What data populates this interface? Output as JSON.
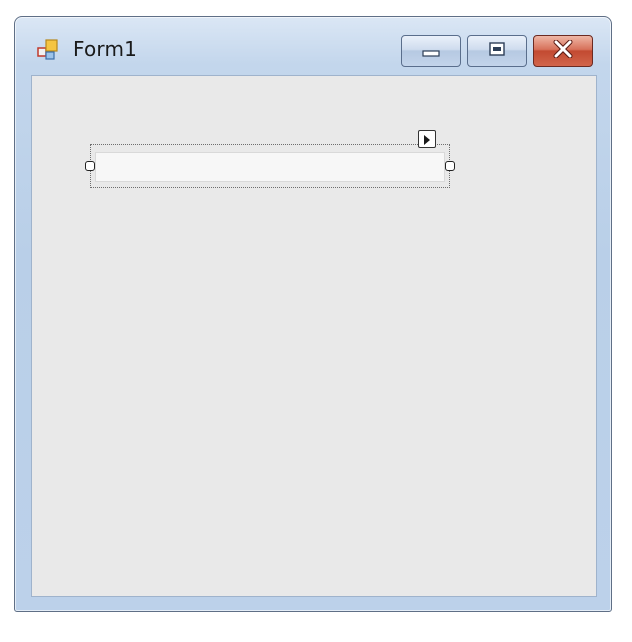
{
  "window": {
    "title": "Form1",
    "icons": {
      "app": "form-app-icon",
      "minimize": "minimize-icon",
      "maximize": "maximize-icon",
      "close": "close-icon",
      "smart_tag": "smart-tag-arrow-icon"
    }
  },
  "form": {
    "textbox": {
      "value": "",
      "placeholder": ""
    }
  },
  "colors": {
    "titlebar": "#c3d6ec",
    "client_background": "#e9e9e9",
    "close_button": "#c24a31"
  }
}
